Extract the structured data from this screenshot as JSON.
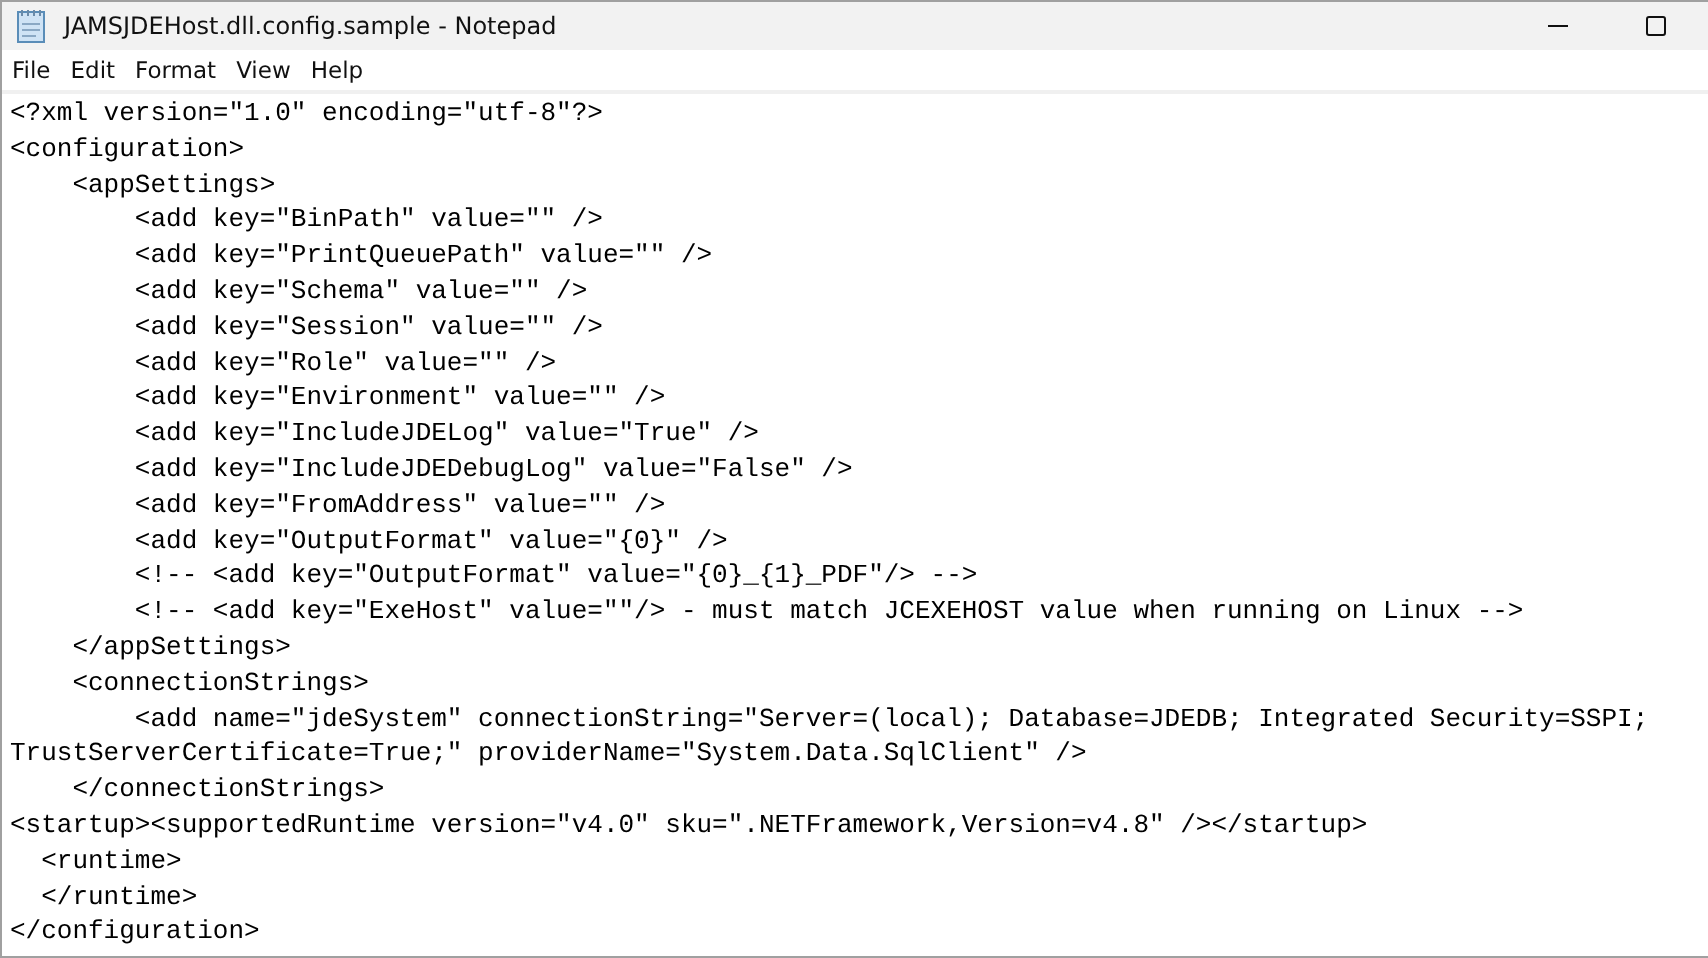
{
  "window": {
    "title": "JAMSJDEHost.dll.config.sample - Notepad"
  },
  "menu": [
    "File",
    "Edit",
    "Format",
    "View",
    "Help"
  ],
  "editor": {
    "lines": [
      "<?xml version=\"1.0\" encoding=\"utf-8\"?>",
      "<configuration>",
      "    <appSettings>",
      "        <add key=\"BinPath\" value=\"\" />",
      "        <add key=\"PrintQueuePath\" value=\"\" />",
      "        <add key=\"Schema\" value=\"\" />",
      "        <add key=\"Session\" value=\"\" />",
      "        <add key=\"Role\" value=\"\" />",
      "        <add key=\"Environment\" value=\"\" />",
      "        <add key=\"IncludeJDELog\" value=\"True\" />",
      "        <add key=\"IncludeJDEDebugLog\" value=\"False\" />",
      "        <add key=\"FromAddress\" value=\"\" />",
      "        <add key=\"OutputFormat\" value=\"{0}\" />",
      "        <!-- <add key=\"OutputFormat\" value=\"{0}_{1}_PDF\"/> -->",
      "        <!-- <add key=\"ExeHost\" value=\"\"/> - must match JCEXEHOST value when running on Linux -->",
      "    </appSettings>",
      "    <connectionStrings>",
      "        <add name=\"jdeSystem\" connectionString=\"Server=(local); Database=JDEDB; Integrated Security=SSPI;",
      "TrustServerCertificate=True;\" providerName=\"System.Data.SqlClient\" />",
      "    </connectionStrings>",
      "<startup><supportedRuntime version=\"v4.0\" sku=\".NETFramework,Version=v4.8\" /></startup>",
      "  <runtime>",
      "  </runtime>",
      "</configuration>"
    ]
  }
}
